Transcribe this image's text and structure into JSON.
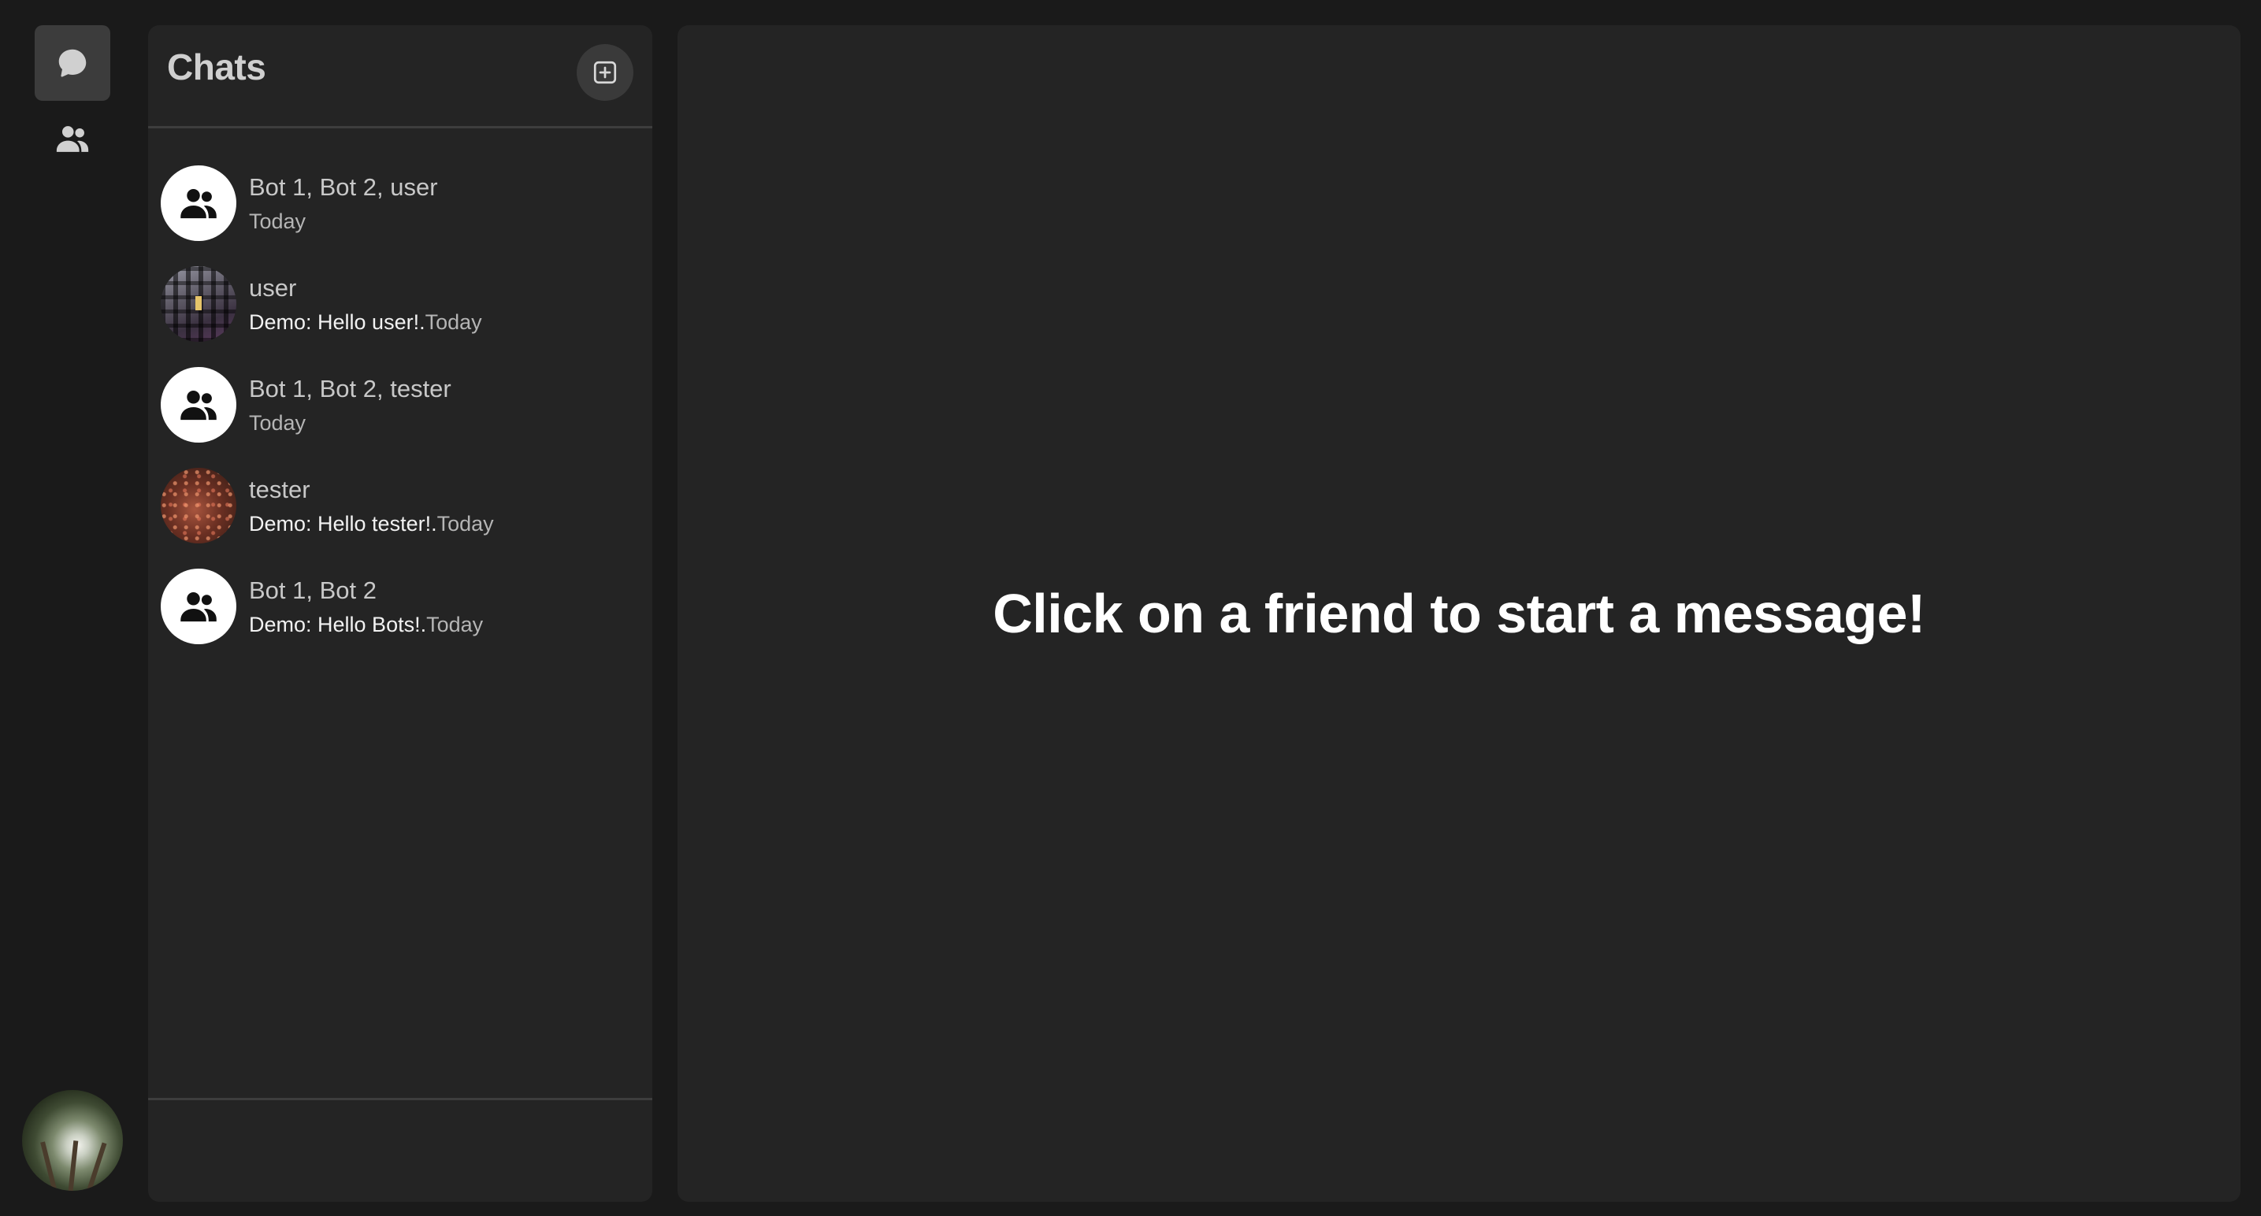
{
  "rail": {
    "items": [
      {
        "name": "chats",
        "icon": "chat-bubble-icon",
        "active": true
      },
      {
        "name": "friends",
        "icon": "users-icon",
        "active": false
      }
    ],
    "profile_icon": "profile-avatar"
  },
  "panel": {
    "title": "Chats",
    "new_chat_icon": "plus-square-icon"
  },
  "chats": [
    {
      "name": "Bot 1, Bot 2, user",
      "preview": "",
      "time": "Today",
      "avatar": "group-icon"
    },
    {
      "name": "user",
      "preview": "Demo: Hello user!.",
      "time": "Today",
      "avatar": "user-photo"
    },
    {
      "name": "Bot 1, Bot 2, tester",
      "preview": "",
      "time": "Today",
      "avatar": "group-icon"
    },
    {
      "name": "tester",
      "preview": "Demo: Hello tester!.",
      "time": "Today",
      "avatar": "tester-photo"
    },
    {
      "name": "Bot 1, Bot 2",
      "preview": "Demo: Hello Bots!.",
      "time": "Today",
      "avatar": "group-icon"
    }
  ],
  "main": {
    "empty_message": "Click on a friend to start a message!"
  }
}
